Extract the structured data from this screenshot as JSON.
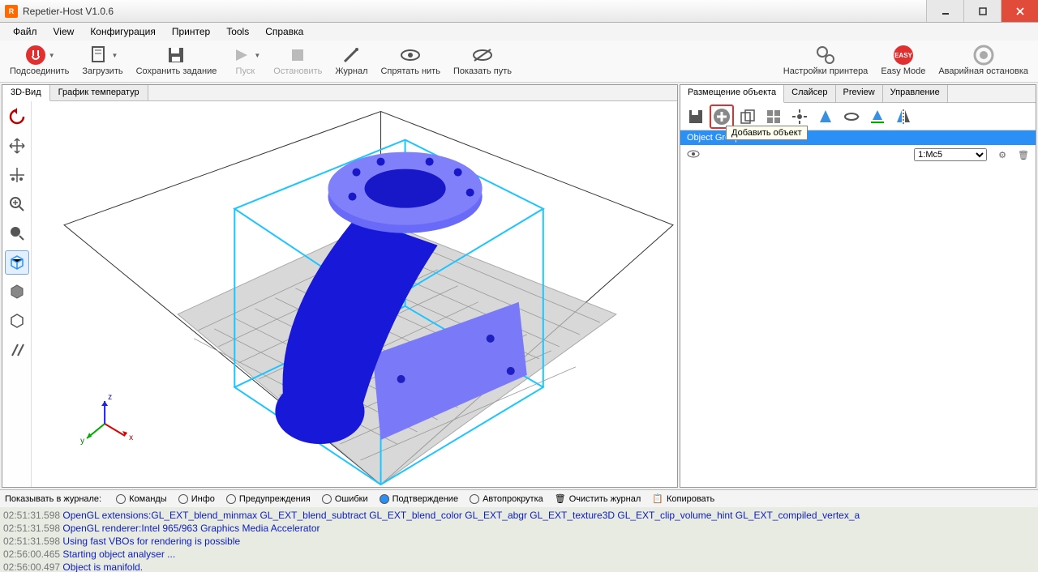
{
  "title": "Repetier-Host V1.0.6",
  "menu": {
    "file": "Файл",
    "view": "View",
    "config": "Конфигурация",
    "printer": "Принтер",
    "tools": "Tools",
    "help": "Справка"
  },
  "toolbar": {
    "connect": "Подсоединить",
    "load": "Загрузить",
    "save": "Сохранить задание",
    "start": "Пуск",
    "stop": "Остановить",
    "log": "Журнал",
    "hide_thread": "Спрятать нить",
    "show_path": "Показать путь",
    "printer_settings": "Настройки принтера",
    "easy_mode": "Easy Mode",
    "emergency": "Аварийная остановка"
  },
  "left_tabs": {
    "view3d": "3D-Вид",
    "temp_graph": "График температур"
  },
  "right_tabs": {
    "placement": "Размещение объекта",
    "slicer": "Слайсер",
    "preview": "Preview",
    "control": "Управление"
  },
  "tooltip_add": "Добавить объект",
  "group_header": "Object Group 1",
  "extruder_select": "1:Mc5",
  "log_controls": {
    "label": "Показывать в журнале:",
    "commands": "Команды",
    "info": "Инфо",
    "warnings": "Предупреждения",
    "errors": "Ошибки",
    "confirm": "Подтверждение",
    "autoscroll": "Автопрокрутка",
    "clear": "Очистить журнал",
    "copy": "Копировать"
  },
  "log_lines": [
    {
      "ts": "02:51:31.598",
      "msg": "OpenGL extensions:GL_EXT_blend_minmax GL_EXT_blend_subtract GL_EXT_blend_color GL_EXT_abgr GL_EXT_texture3D GL_EXT_clip_volume_hint GL_EXT_compiled_vertex_a"
    },
    {
      "ts": "02:51:31.598",
      "msg": "OpenGL renderer:Intel 965/963 Graphics Media Accelerator"
    },
    {
      "ts": "02:51:31.598",
      "msg": "Using fast VBOs for rendering is possible"
    },
    {
      "ts": "02:56:00.465",
      "msg": "Starting object analyser ..."
    },
    {
      "ts": "02:56:00.497",
      "msg": "Object is manifold."
    }
  ]
}
